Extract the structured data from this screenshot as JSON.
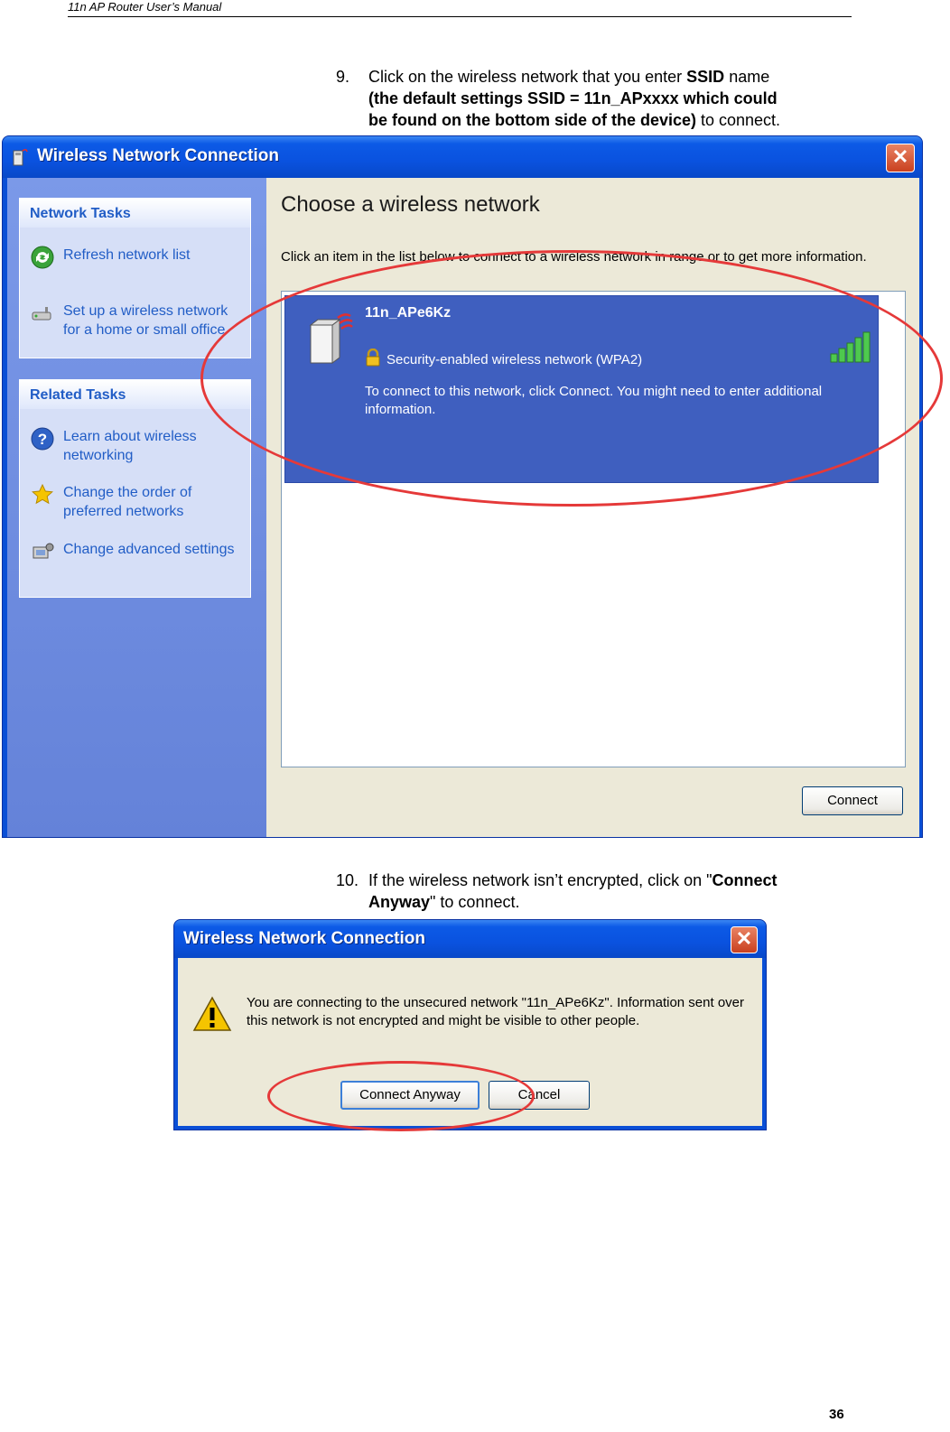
{
  "header": {
    "title": "11n AP Router User’s Manual"
  },
  "step9": {
    "number": "9.",
    "line1_a": "Click on the wireless network that you enter ",
    "line1_bold": "SSID",
    "line1_b": " name",
    "line2_bold": "(the default settings SSID = 11n_APxxxx which could",
    "line3_bold": "be found on the bottom side of the device)",
    "line3_b": " to connect."
  },
  "window1": {
    "title": "Wireless Network Connection",
    "network_tasks": {
      "heading": "Network Tasks",
      "items": [
        {
          "label": "Refresh network list",
          "icon": "refresh-icon"
        },
        {
          "label": "Set up a wireless network for a home or small office",
          "icon": "setup-wizard-icon"
        }
      ]
    },
    "related_tasks": {
      "heading": "Related Tasks",
      "items": [
        {
          "label": "Learn about wireless networking",
          "icon": "help-icon"
        },
        {
          "label": "Change the order of preferred networks",
          "icon": "star-icon"
        },
        {
          "label": "Change advanced settings",
          "icon": "settings-icon"
        }
      ]
    },
    "heading": "Choose a wireless network",
    "instruction": "Click an item in the list below to connect to a wireless network in range or to get more information.",
    "network": {
      "ssid": "11n_APe6Kz",
      "security": "Security-enabled wireless network (WPA2)",
      "message": "To connect to this network, click Connect. You might need to enter additional information.",
      "signal_strength": "5/5"
    },
    "connect_button": "Connect"
  },
  "step10": {
    "number": "10.",
    "line1_a": "If the wireless network isn’t encrypted, click on \"",
    "line1_bold": "Connect",
    "line2_bold": "Anyway",
    "line2_b": "\" to connect."
  },
  "window2": {
    "title": "Wireless Network Connection",
    "message": "You are connecting to the unsecured network \"11n_APe6Kz\". Information sent over this network is not encrypted and might be visible to other people.",
    "connect_anyway_button": "Connect Anyway",
    "cancel_button": "Cancel"
  },
  "page_number": "36",
  "colors": {
    "highlight_oval": "#e53939",
    "title_bar": "#0a52df",
    "selected_item": "#3f5fbf"
  }
}
